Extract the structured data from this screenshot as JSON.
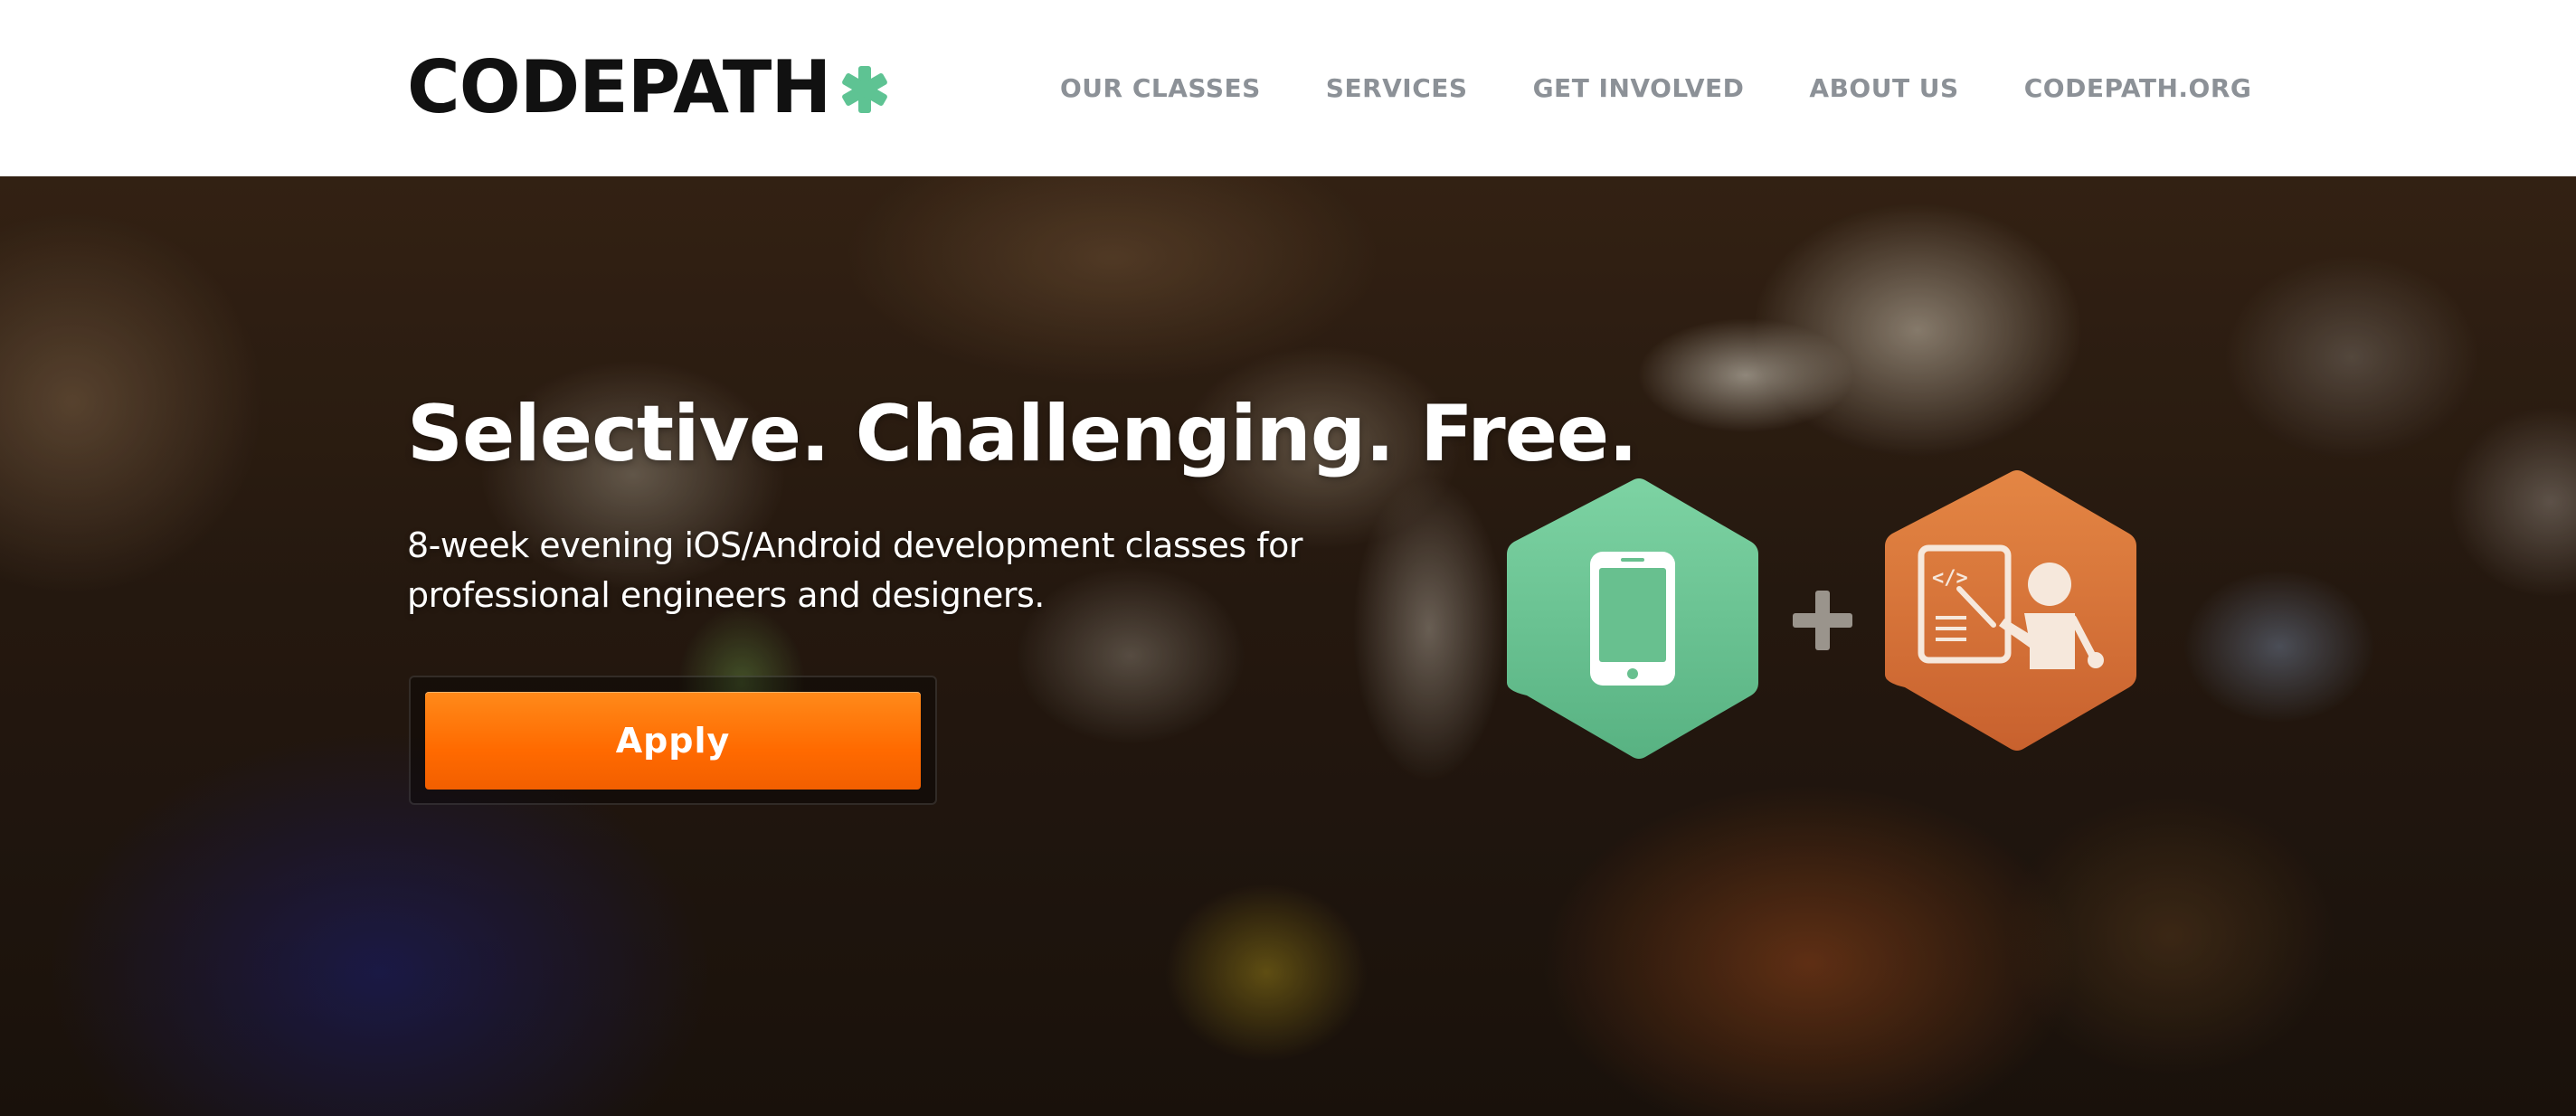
{
  "header": {
    "logo_text": "CODEPATH",
    "logo_accent_color": "#5ec393",
    "nav": [
      {
        "label": "OUR CLASSES"
      },
      {
        "label": "SERVICES"
      },
      {
        "label": "GET INVOLVED"
      },
      {
        "label": "ABOUT US"
      },
      {
        "label": "CODEPATH.ORG"
      }
    ]
  },
  "hero": {
    "title": "Selective. Challenging. Free.",
    "subtitle": "8-week evening iOS/Android development classes for professional engineers and designers.",
    "apply_label": "Apply",
    "apply_color": "#ff6a00",
    "icons": {
      "left": "mobile-phone-icon",
      "middle": "plus-icon",
      "right": "teacher-whiteboard-icon",
      "left_color": "#6cc596",
      "right_color": "#d9733b",
      "whiteboard_code": "</>"
    }
  }
}
